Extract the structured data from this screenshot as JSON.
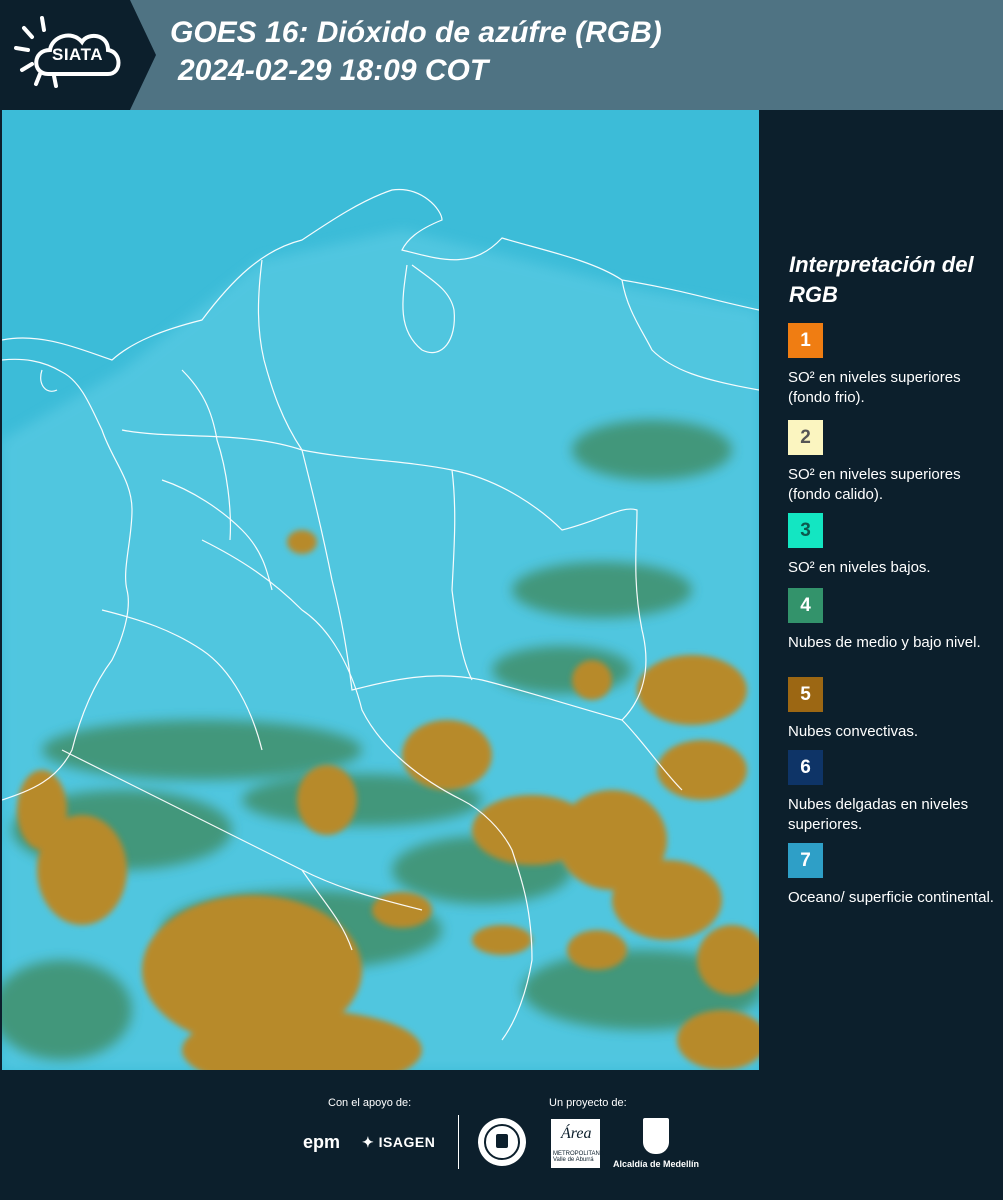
{
  "header": {
    "logo_text": "SIATA",
    "title_line1": "GOES 16: Dióxido de azúfre (RGB)",
    "title_line2": "2024-02-29 18:09 COT"
  },
  "legend": {
    "title": "Interpretación del RGB",
    "items": [
      {
        "number": "1",
        "label": "SO² en niveles superiores (fondo frio).",
        "color": "#f07d12"
      },
      {
        "number": "2",
        "label": "SO² en niveles superiores (fondo calido).",
        "color": "#fbf5c0"
      },
      {
        "number": "3",
        "label": "SO² en niveles bajos.",
        "color": "#13e6c2"
      },
      {
        "number": "4",
        "label": "Nubes de medio y bajo nivel.",
        "color": "#33936b"
      },
      {
        "number": "5",
        "label": "Nubes convectivas.",
        "color": "#9c6713"
      },
      {
        "number": "6",
        "label": "Nubes delgadas en niveles superiores.",
        "color": "#0e3467"
      },
      {
        "number": "7",
        "label": "Oceano/ superficie continental.",
        "color": "#2e9fc7"
      }
    ]
  },
  "footer": {
    "support_label": "Con el apoyo de:",
    "project_label": "Un proyecto de:",
    "epm": "epm",
    "isagen": "ISAGEN",
    "area_logo": "Área",
    "area_sub": "METROPOLITANA Valle de Aburrá",
    "alcaldia": "Alcaldía de Medellín"
  },
  "colors": {
    "background": "#0c1f2c",
    "header": "#4f7383",
    "map_base": "#3cc0dc",
    "cloud_convective": "#b98a2a",
    "cloud_mid": "#3d8f6a"
  }
}
